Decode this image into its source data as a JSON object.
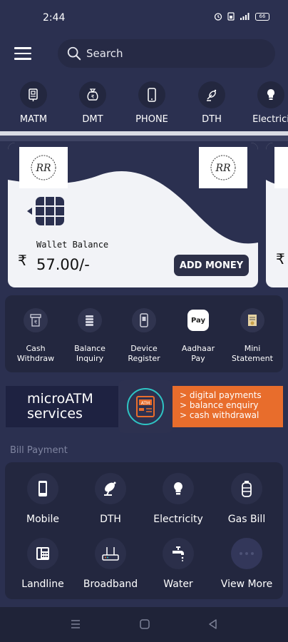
{
  "status_bar": {
    "time": "2:44",
    "battery": "66"
  },
  "search": {
    "placeholder": "Search"
  },
  "services": [
    {
      "label": "MATM",
      "icon": "matm-icon"
    },
    {
      "label": "DMT",
      "icon": "money-bag-icon"
    },
    {
      "label": "PHONE",
      "icon": "phone-icon"
    },
    {
      "label": "DTH",
      "icon": "satellite-icon"
    },
    {
      "label": "Electrici",
      "icon": "bulb-icon"
    }
  ],
  "wallet": {
    "logo_text": "RR",
    "label": "Wallet Balance",
    "currency": "₹",
    "amount": "57.00/-",
    "add_money": "ADD MONEY"
  },
  "quick_actions": [
    {
      "line1": "Cash",
      "line2": "Withdraw",
      "icon": "cash-withdraw-icon"
    },
    {
      "line1": "Balance",
      "line2": "Inquiry",
      "icon": "balance-inquiry-icon"
    },
    {
      "line1": "Device",
      "line2": "Register",
      "icon": "device-icon"
    },
    {
      "line1": "Aadhaar",
      "line2": "Pay",
      "icon": "aadhaar-pay-icon",
      "badge": "Pay"
    },
    {
      "line1": "Mini",
      "line2": "Statement",
      "icon": "statement-icon"
    }
  ],
  "banner": {
    "title_line1": "microATM",
    "title_line2": "services",
    "atm_label": "ATM",
    "points": [
      "> digital payments",
      "> balance enquiry",
      "> cash withdrawal"
    ]
  },
  "bill_payment": {
    "title": "Bill Payment",
    "items": [
      {
        "label": "Mobile",
        "icon": "mobile-icon"
      },
      {
        "label": "DTH",
        "icon": "satellite-dish-icon"
      },
      {
        "label": "Electricity",
        "icon": "bulb-icon"
      },
      {
        "label": "Gas Bill",
        "icon": "gas-cylinder-icon"
      },
      {
        "label": "Landline",
        "icon": "landline-icon"
      },
      {
        "label": "Broadband",
        "icon": "router-icon"
      },
      {
        "label": "Water",
        "icon": "tap-icon"
      },
      {
        "label": "View More",
        "icon": "more-icon"
      }
    ]
  },
  "colors": {
    "background": "#2b3050",
    "panel": "#23273f",
    "accent_orange": "#e86d2c",
    "card": "#f2f3f7"
  }
}
